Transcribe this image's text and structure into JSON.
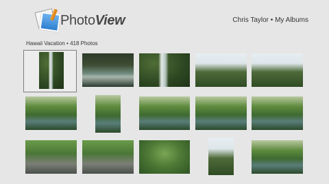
{
  "app": {
    "logo_word1": "Photo",
    "logo_word2": "View",
    "user_name": "Chris Taylor",
    "separator": "•",
    "nav_link": "My Albums"
  },
  "album": {
    "title": "Hawaii Vacation",
    "separator": "•",
    "count": "418 Photos"
  },
  "photos": [
    {
      "row": 1,
      "col": 1,
      "style": "g-waterfall",
      "selected": true
    },
    {
      "row": 1,
      "col": 2,
      "style": "g-pool"
    },
    {
      "row": 1,
      "col": 3,
      "style": "g-waterfall"
    },
    {
      "row": 1,
      "col": 4,
      "style": "g-bridge"
    },
    {
      "row": 1,
      "col": 5,
      "style": "g-bridge"
    },
    {
      "row": 2,
      "col": 1,
      "style": "g-stream"
    },
    {
      "row": 2,
      "col": 2,
      "style": "g-stream"
    },
    {
      "row": 2,
      "col": 3,
      "style": "g-stream"
    },
    {
      "row": 2,
      "col": 4,
      "style": "g-stream"
    },
    {
      "row": 2,
      "col": 5,
      "style": "g-stream"
    },
    {
      "row": 3,
      "col": 1,
      "style": "g-rocks"
    },
    {
      "row": 3,
      "col": 2,
      "style": "g-rocks"
    },
    {
      "row": 3,
      "col": 3,
      "style": "g-jungle"
    },
    {
      "row": 3,
      "col": 4,
      "style": "g-bridge"
    },
    {
      "row": 3,
      "col": 5,
      "style": "g-stream"
    }
  ]
}
